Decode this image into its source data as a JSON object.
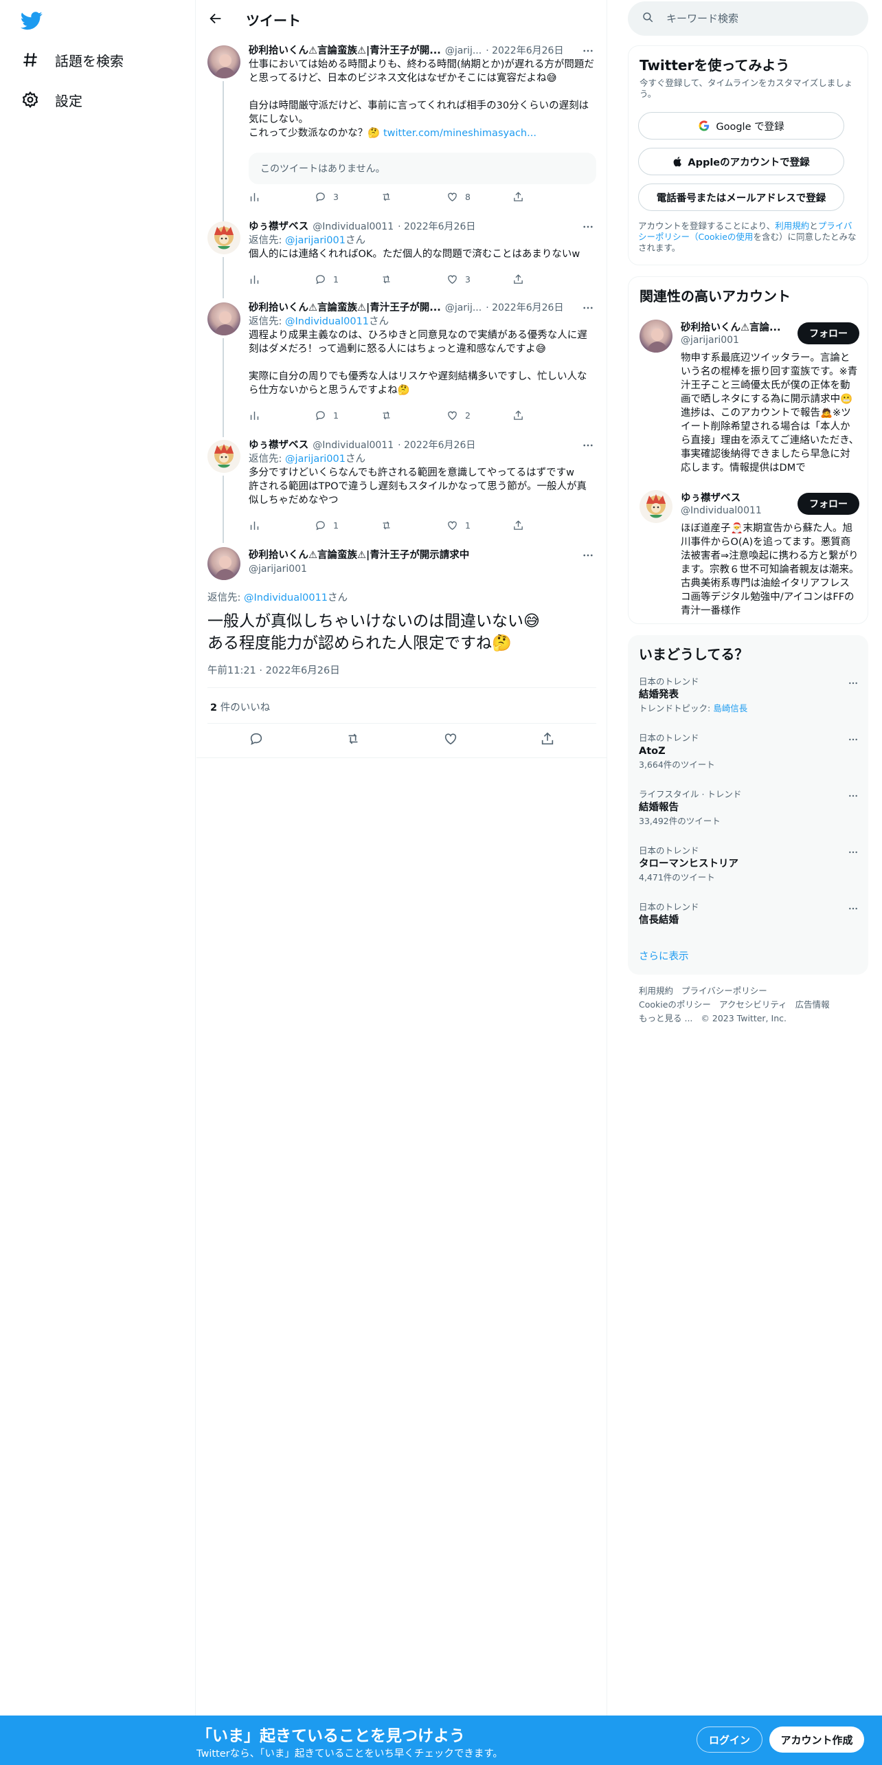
{
  "colors": {
    "accent": "#1d9bf0",
    "text": "#0f1419",
    "muted": "#536471"
  },
  "nav": {
    "items": [
      {
        "label": "話題を検索",
        "icon": "hashtag-icon"
      },
      {
        "label": "設定",
        "icon": "gear-icon"
      }
    ]
  },
  "header": {
    "title": "ツイート"
  },
  "tweets": [
    {
      "name": "砂利拾いくん⚠言論蛮族⚠|青汁王子が開...",
      "handle": "@jarij...",
      "date": "· 2022年6月26日",
      "text_1": "仕事においては始める時間よりも、終わる時間(納期とか)が遅れる方が問題だと思ってるけど、日本のビジネス文化はなぜかそこには寛容だよね😅\n\n自分は時間厳守派だけど、事前に言ってくれれば相手の30分くらいの遅刻は気にしない。\nこれって少数派なのかな？🤔 ",
      "link": "twitter.com/mineshimasyach...",
      "quote": "このツイートはありません。",
      "views": "",
      "replies": "3",
      "retweets": "",
      "likes": "8"
    },
    {
      "name": "ゆぅ襟ザベス",
      "handle": "@Individual0011",
      "date": "· 2022年6月26日",
      "reply_label": "返信先: ",
      "reply_to": "@jarijari001",
      "reply_suffix": "さん",
      "text": "個人的には連絡くれればOK。ただ個人的な問題で済むことはあまりないw",
      "replies": "1",
      "likes": "3"
    },
    {
      "name": "砂利拾いくん⚠言論蛮族⚠|青汁王子が開...",
      "handle": "@jarij...",
      "date": "· 2022年6月26日",
      "reply_label": "返信先: ",
      "reply_to": "@Individual0011",
      "reply_suffix": "さん",
      "text": "週程より成果主義なのは、ひろゆきと同意見なので実績がある優秀な人に遅刻はダメだろ！って過剰に怒る人にはちょっと違和感なんですよ😅\n\n実際に自分の周りでも優秀な人はリスケや遅刻結構多いですし、忙しい人なら仕方ないからと思うんですよね🤔",
      "replies": "1",
      "likes": "2"
    },
    {
      "name": "ゆぅ襟ザベス",
      "handle": "@Individual0011",
      "date": "· 2022年6月26日",
      "reply_label": "返信先: ",
      "reply_to": "@jarijari001",
      "reply_suffix": "さん",
      "text": "多分ですけどいくらなんでも許される範囲を意識してやってるはずですw\n許される範囲はTPOで違うし遅刻もスタイルかなって思う節が。一般人が真似しちゃだめなやつ",
      "replies": "1",
      "likes": "1"
    }
  ],
  "focus": {
    "name": "砂利拾いくん⚠言論蛮族⚠|青汁王子が開示請求中",
    "handle": "@jarijari001",
    "reply_label": "返信先: ",
    "reply_to": "@Individual0011",
    "reply_suffix": "さん",
    "text": "一般人が真似しちゃいけないのは間違いない😅\nある程度能力が認められた人限定ですね🤔",
    "timestamp": "午前11:21 · 2022年6月26日",
    "likes_count": "2",
    "likes_label": " 件のいいね"
  },
  "search": {
    "placeholder": "キーワード検索"
  },
  "signup": {
    "title": "Twitterを使ってみよう",
    "subtitle": "今すぐ登録して、タイムラインをカスタマイズしましょう。",
    "google": "Google で登録",
    "apple": "Appleのアカウントで登録",
    "phone": "電話番号またはメールアドレスで登録",
    "terms_1": "アカウントを登録することにより、",
    "terms_link_1": "利用規約",
    "terms_2": "と",
    "terms_link_2": "プライバシーポリシー（Cookieの使用",
    "terms_3": "を含む）に同意したとみなされます。"
  },
  "related": {
    "title": "関連性の高いアカウント",
    "follow_label": "フォロー",
    "accounts": [
      {
        "name": "砂利拾いくん⚠言論...",
        "handle": "@jarijari001",
        "bio": "物申す系最底辺ツイッタラー。言論という名の棍棒を振り回す蛮族です。※青汁王子こと三崎優太氏が僕の正体を動画で晒しネタにする為に開示請求中😬進捗は、このアカウントで報告🙇※ツイート削除希望される場合は「本人から直接」理由を添えてご連絡いただき、事実確認後納得できましたら早急に対応します。情報提供はDMで"
      },
      {
        "name": "ゆぅ襟ザベス",
        "handle": "@Individual0011",
        "bio": "ほぼ道産子🎅末期宣告から蘇た人。旭川事件からO(A)を追ってます。悪質商法被害者⇒注意喚起に携わる方と繋がります。宗教６世不可知論者親友は潮来。古典美術系専門は油絵イタリアフレスコ画等デジタル勉強中/アイコンはFFの青汁一番様作"
      }
    ]
  },
  "trends": {
    "title": "いまどうしてる？",
    "items": [
      {
        "context": "日本のトレンド",
        "name": "結婚発表",
        "extra_label": "トレンドトピック: ",
        "extra_link": "島崎信長"
      },
      {
        "context": "日本のトレンド",
        "name": "AtoZ",
        "count": "3,664件のツイート"
      },
      {
        "context": "ライフスタイル · トレンド",
        "name": "結婚報告",
        "count": "33,492件のツイート"
      },
      {
        "context": "日本のトレンド",
        "name": "タローマンヒストリア",
        "count": "4,471件のツイート"
      },
      {
        "context": "日本のトレンド",
        "name": "信長結婚"
      }
    ],
    "show_more": "さらに表示"
  },
  "footer": {
    "terms": "利用規約",
    "privacy": "プライバシーポリシー",
    "cookie": "Cookieのポリシー",
    "accessibility": "アクセシビリティ",
    "ads": "広告情報",
    "more": "もっと見る ...",
    "copyright": "© 2023 Twitter, Inc."
  },
  "bottom_bar": {
    "title": "「いま」起きていることを見つけよう",
    "subtitle": "Twitterなら、「いま」起きていることをいち早くチェックできます。",
    "login": "ログイン",
    "signup": "アカウント作成"
  }
}
